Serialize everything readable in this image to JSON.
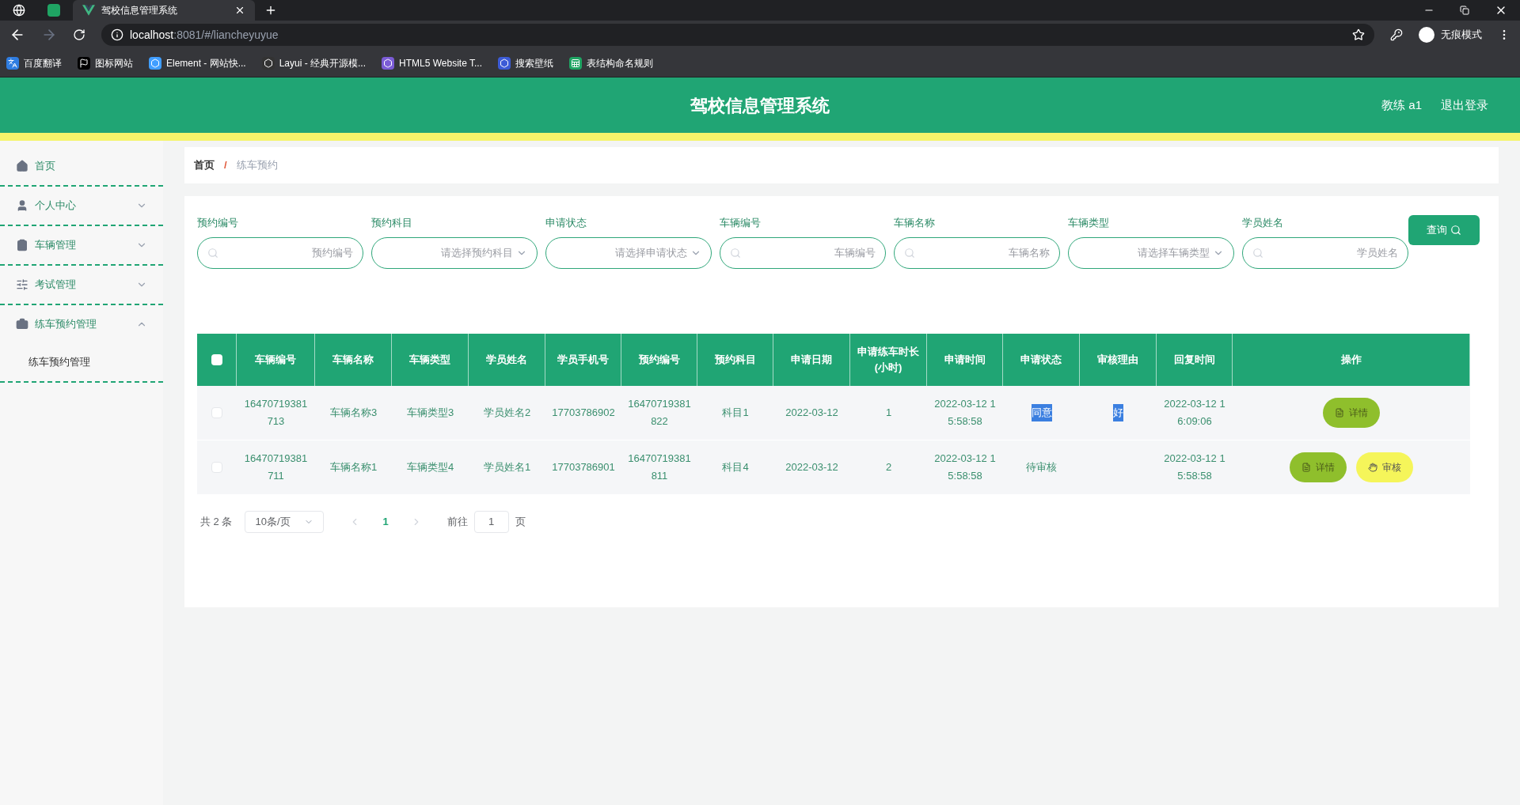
{
  "browser": {
    "tab_title": "驾校信息管理系统",
    "url_host": "localhost",
    "url_rest": ":8081/#/liancheyuyue",
    "incognito_label": "无痕模式",
    "bookmarks": [
      {
        "label": "百度翻译",
        "kind": "translate"
      },
      {
        "label": "图标网站",
        "kind": "flag"
      },
      {
        "label": "Element - 网站快...",
        "kind": "element"
      },
      {
        "label": "Layui - 经典开源模...",
        "kind": "layui"
      },
      {
        "label": "HTML5 Website T...",
        "kind": "html5"
      },
      {
        "label": "搜索壁纸",
        "kind": "wallpaper"
      },
      {
        "label": "表结构命名规则",
        "kind": "sheet"
      }
    ]
  },
  "header": {
    "title": "驾校信息管理系统",
    "user": "教练 a1",
    "logout": "退出登录"
  },
  "sidebar": {
    "items": [
      {
        "label": "首页"
      },
      {
        "label": "个人中心",
        "expanded": false
      },
      {
        "label": "车辆管理",
        "expanded": false
      },
      {
        "label": "考试管理",
        "expanded": false
      },
      {
        "label": "练车预约管理",
        "expanded": true,
        "children": [
          {
            "label": "练车预约管理"
          }
        ]
      }
    ]
  },
  "breadcrumb_separator": "/",
  "breadcrumb": [
    {
      "label": "首页",
      "current": false
    },
    {
      "label": "练车预约",
      "current": true
    }
  ],
  "filters": [
    {
      "label": "预约编号",
      "placeholder": "预约编号",
      "kind": "input"
    },
    {
      "label": "预约科目",
      "placeholder": "请选择预约科目",
      "kind": "select"
    },
    {
      "label": "申请状态",
      "placeholder": "请选择申请状态",
      "kind": "select"
    },
    {
      "label": "车辆编号",
      "placeholder": "车辆编号",
      "kind": "input"
    },
    {
      "label": "车辆名称",
      "placeholder": "车辆名称",
      "kind": "input"
    },
    {
      "label": "车辆类型",
      "placeholder": "请选择车辆类型",
      "kind": "select"
    },
    {
      "label": "学员姓名",
      "placeholder": "学员姓名",
      "kind": "input"
    }
  ],
  "query_button": "查询",
  "table": {
    "header_checked": false,
    "columns": [
      "车辆编号",
      "车辆名称",
      "车辆类型",
      "学员姓名",
      "学员手机号",
      "预约编号",
      "预约科目",
      "申请日期",
      "申请练车时长(小时)",
      "申请时间",
      "申请状态",
      "审核理由",
      "回复时间",
      "操作"
    ],
    "rows": [
      {
        "checked": false,
        "cells": [
          {
            "text": "16470719381713",
            "highlighted": false
          },
          {
            "text": "车辆名称3",
            "highlighted": false
          },
          {
            "text": "车辆类型3",
            "highlighted": false
          },
          {
            "text": "学员姓名2",
            "highlighted": false
          },
          {
            "text": "17703786902",
            "highlighted": false
          },
          {
            "text": "16470719381822",
            "highlighted": false
          },
          {
            "text": "科目1",
            "highlighted": false
          },
          {
            "text": "2022-03-12",
            "highlighted": false
          },
          {
            "text": "1",
            "highlighted": false
          },
          {
            "text": "2022-03-12 15:58:58",
            "highlighted": false
          },
          {
            "text": "同意",
            "highlighted": true
          },
          {
            "text": "好",
            "highlighted": true
          },
          {
            "text": "2022-03-12 16:09:06",
            "highlighted": false
          }
        ],
        "actions": [
          {
            "label": "详情",
            "kind": "detail"
          }
        ]
      },
      {
        "checked": false,
        "cells": [
          {
            "text": "16470719381711",
            "highlighted": false
          },
          {
            "text": "车辆名称1",
            "highlighted": false
          },
          {
            "text": "车辆类型4",
            "highlighted": false
          },
          {
            "text": "学员姓名1",
            "highlighted": false
          },
          {
            "text": "17703786901",
            "highlighted": false
          },
          {
            "text": "16470719381811",
            "highlighted": false
          },
          {
            "text": "科目4",
            "highlighted": false
          },
          {
            "text": "2022-03-12",
            "highlighted": false
          },
          {
            "text": "2",
            "highlighted": false
          },
          {
            "text": "2022-03-12 15:58:58",
            "highlighted": false
          },
          {
            "text": "待审核",
            "highlighted": false
          },
          null,
          {
            "text": "2022-03-12 15:58:58",
            "highlighted": false
          }
        ],
        "actions": [
          {
            "label": "详情",
            "kind": "detail"
          },
          {
            "label": "审核",
            "kind": "review"
          }
        ]
      }
    ]
  },
  "pagination": {
    "total": "共 2 条",
    "page_size": "10条/页",
    "pages": [
      {
        "label": "1",
        "selected": true
      }
    ],
    "goto_label": "前往",
    "goto_value": "1",
    "goto_suffix": "页"
  }
}
